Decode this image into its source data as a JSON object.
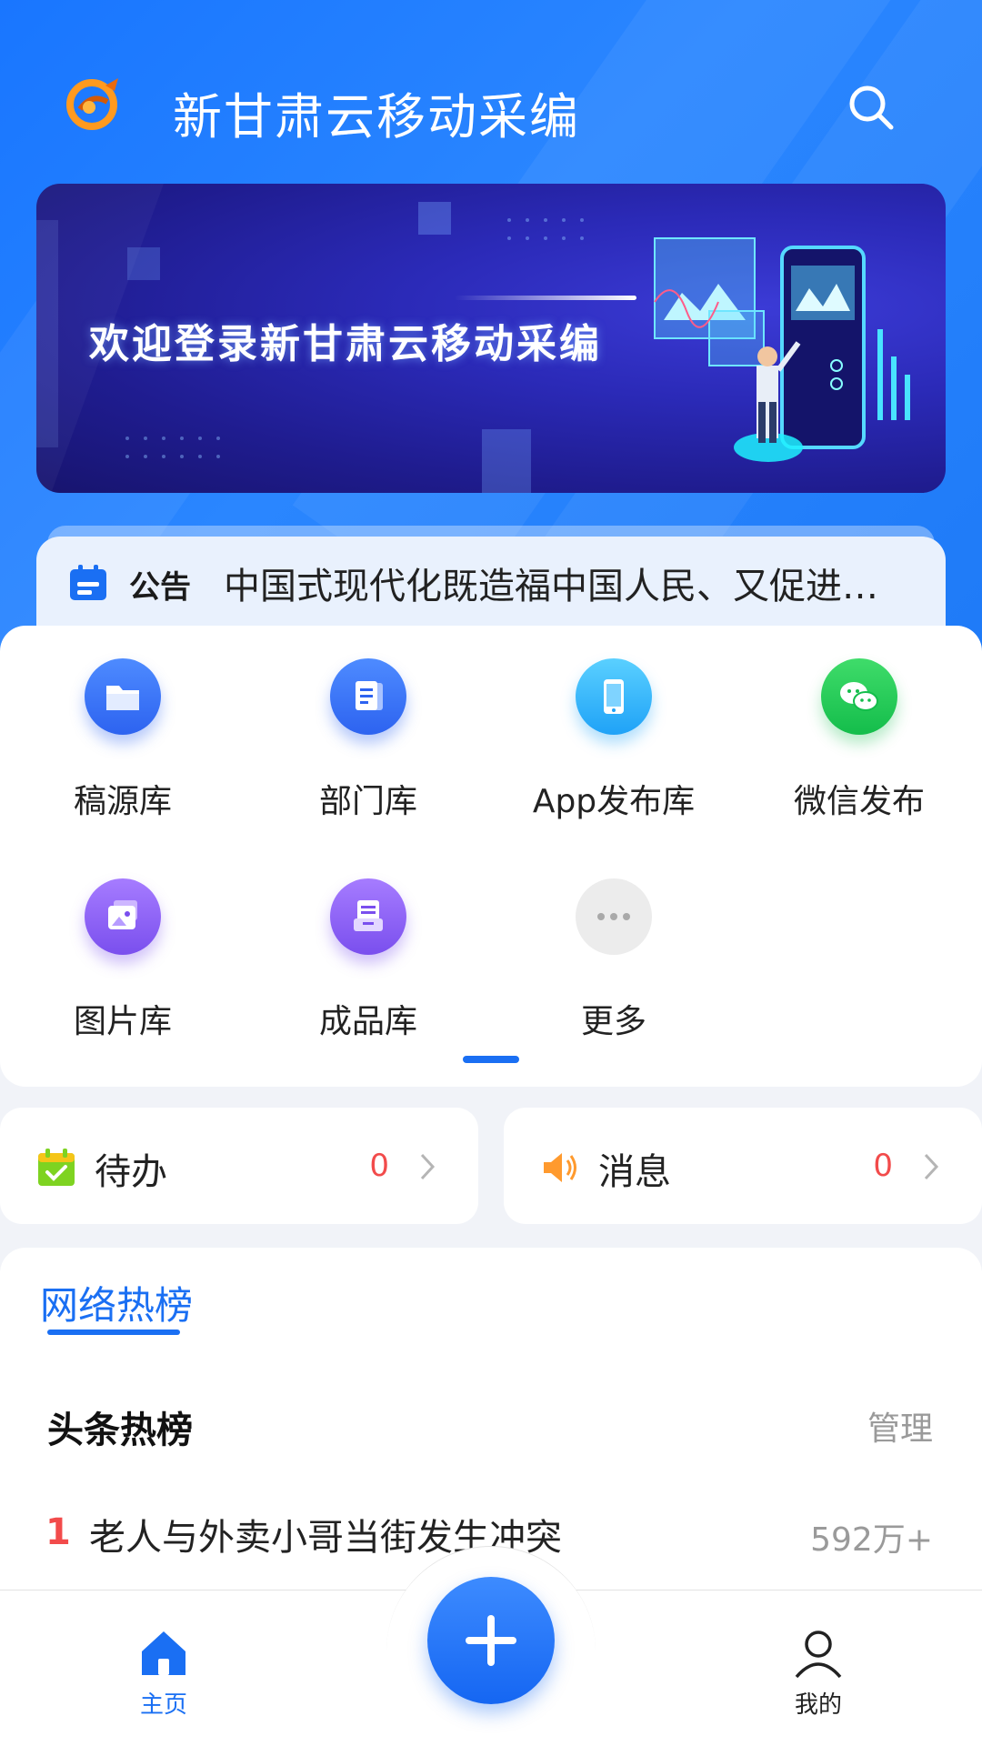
{
  "header": {
    "title": "新甘肃云移动采编"
  },
  "banner": {
    "text": "欢迎登录新甘肃云移动采编"
  },
  "notice": {
    "label": "公告",
    "text": "中国式现代化既造福中国人民、又促进…"
  },
  "grid": {
    "items": [
      {
        "label": "稿源库",
        "icon": "folder-icon"
      },
      {
        "label": "部门库",
        "icon": "document-icon"
      },
      {
        "label": "App发布库",
        "icon": "phone-icon"
      },
      {
        "label": "微信发布",
        "icon": "wechat-icon"
      },
      {
        "label": "图片库",
        "icon": "image-icon"
      },
      {
        "label": "成品库",
        "icon": "archive-icon"
      },
      {
        "label": "更多",
        "icon": "more-icon"
      }
    ]
  },
  "todo": {
    "label": "待办",
    "count": "0"
  },
  "messages": {
    "label": "消息",
    "count": "0"
  },
  "hot": {
    "tab": "网络热榜",
    "title": "头条热榜",
    "manage": "管理",
    "items": [
      {
        "rank": "1",
        "text": "老人与外卖小哥当街发生冲突",
        "count": "592万+"
      }
    ]
  },
  "nav": {
    "home": "主页",
    "mine": "我的"
  },
  "colors": {
    "accent": "#1a6ff3",
    "alert": "#f24b4b"
  }
}
